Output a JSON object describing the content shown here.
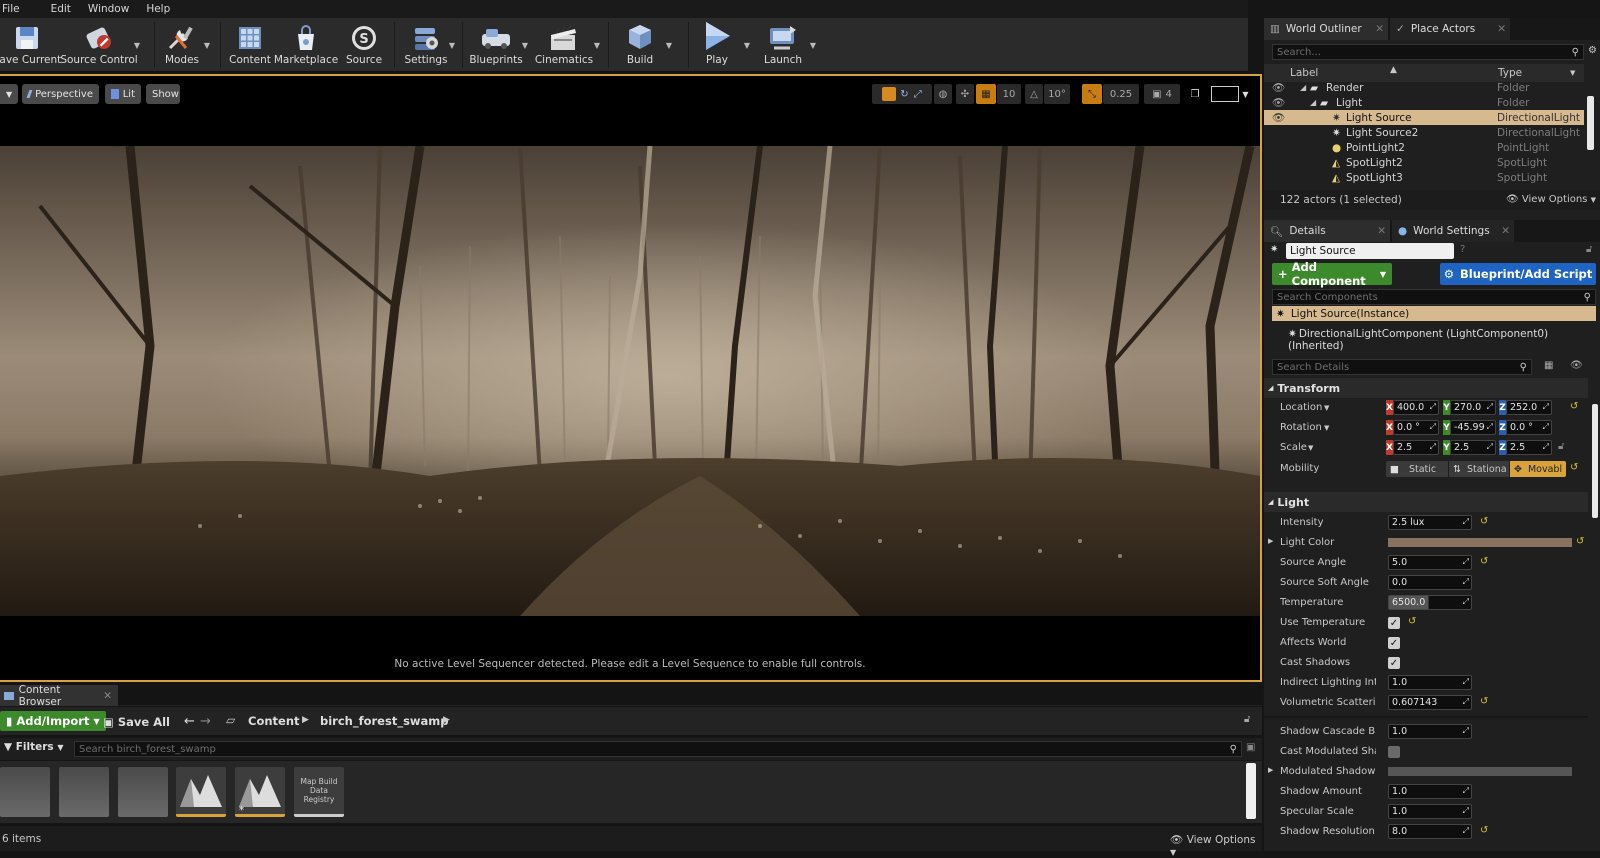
{
  "menu": {
    "items": [
      "File",
      "Edit",
      "Window",
      "Help"
    ]
  },
  "toolbar": {
    "buttons": [
      {
        "label": "Save Current",
        "icon": "save-icon"
      },
      {
        "label": "Source Control",
        "icon": "source-control-icon"
      },
      {
        "label": "Modes",
        "icon": "modes-icon"
      },
      {
        "label": "Content",
        "icon": "content-icon"
      },
      {
        "label": "Marketplace",
        "icon": "marketplace-icon"
      },
      {
        "label": "Source",
        "icon": "source-icon"
      },
      {
        "label": "Settings",
        "icon": "settings-icon"
      },
      {
        "label": "Blueprints",
        "icon": "blueprints-icon"
      },
      {
        "label": "Cinematics",
        "icon": "cinematics-icon"
      },
      {
        "label": "Build",
        "icon": "build-icon"
      },
      {
        "label": "Play",
        "icon": "play-icon"
      },
      {
        "label": "Launch",
        "icon": "launch-icon"
      }
    ]
  },
  "viewport": {
    "perspective": "Perspective",
    "lit": "Lit",
    "show": "Show",
    "grid_snap": "10",
    "rotation_snap": "10°",
    "scale_snap": "0.25",
    "camera_speed": "4",
    "sequencer_message": "No active Level Sequencer detected. Please edit a Level Sequence to enable full controls."
  },
  "content_browser": {
    "tab": "Content Browser",
    "add_import": "Add/Import",
    "save_all": "Save All",
    "breadcrumb": [
      "Content",
      "birch_forest_swamp"
    ],
    "filters": "Filters",
    "search_placeholder": "Search birch_forest_swamp",
    "map_registry": "Map Build Data Registry",
    "item_count": "6 items",
    "view_options": "View Options"
  },
  "outliner": {
    "tab_outliner": "World Outliner",
    "tab_place": "Place Actors",
    "search_placeholder": "Search...",
    "col_label": "Label",
    "col_type": "Type",
    "rows": [
      {
        "name": "Render",
        "type": "Folder"
      },
      {
        "name": "Light",
        "type": "Folder"
      },
      {
        "name": "Light Source",
        "type": "DirectionalLight"
      },
      {
        "name": "Light Source2",
        "type": "DirectionalLight"
      },
      {
        "name": "PointLight2",
        "type": "PointLight"
      },
      {
        "name": "SpotLight2",
        "type": "SpotLight"
      },
      {
        "name": "SpotLight3",
        "type": "SpotLight"
      }
    ],
    "status": "122 actors (1 selected)",
    "view_options": "View Options"
  },
  "details": {
    "tab_details": "Details",
    "tab_world": "World Settings",
    "actor_name": "Light Source",
    "add_component": "Add Component",
    "blueprint_script": "Blueprint/Add Script",
    "search_components": "Search Components",
    "instance": "Light Source(Instance)",
    "component": "DirectionalLightComponent (LightComponent0) (Inherited)",
    "search_details": "Search Details",
    "transform": {
      "title": "Transform",
      "location_label": "Location",
      "rotation_label": "Rotation",
      "scale_label": "Scale",
      "mobility_label": "Mobility",
      "location": [
        "400.0",
        "270.0",
        "252.0"
      ],
      "rotation": [
        "0.0 °",
        "-45.99",
        "0.0 °"
      ],
      "scale": [
        "2.5",
        "2.5",
        "2.5"
      ],
      "axes": [
        "X",
        "Y",
        "Z"
      ],
      "mobility_options": [
        "Static",
        "Stationa",
        "Movabl"
      ]
    },
    "light": {
      "title": "Light",
      "intensity_label": "Intensity",
      "intensity": "2.5 lux",
      "color_label": "Light Color",
      "source_angle_label": "Source Angle",
      "source_angle": "5.0",
      "soft_angle_label": "Source Soft Angle",
      "soft_angle": "0.0",
      "temperature_label": "Temperature",
      "temperature": "6500.0",
      "use_temperature_label": "Use Temperature",
      "affects_world_label": "Affects World",
      "cast_shadows_label": "Cast Shadows",
      "indirect_label": "Indirect Lighting Intens",
      "indirect": "1.0",
      "volumetric_label": "Volumetric Scattering I",
      "volumetric": "0.607143",
      "cascade_bias_label": "Shadow Cascade Bias D",
      "cascade_bias": "1.0",
      "modulated_label": "Cast Modulated Shadov",
      "mod_color_label": "Modulated Shadow Col",
      "shadow_amount_label": "Shadow Amount",
      "shadow_amount": "1.0",
      "specular_label": "Specular Scale",
      "specular": "1.0",
      "resolution_label": "Shadow Resolution Sca",
      "resolution": "8.0"
    }
  },
  "colors": {
    "accent": "#d8a33a",
    "green": "#3d8a2d",
    "blue": "#1f64c2",
    "light_color": "#8a7260"
  }
}
